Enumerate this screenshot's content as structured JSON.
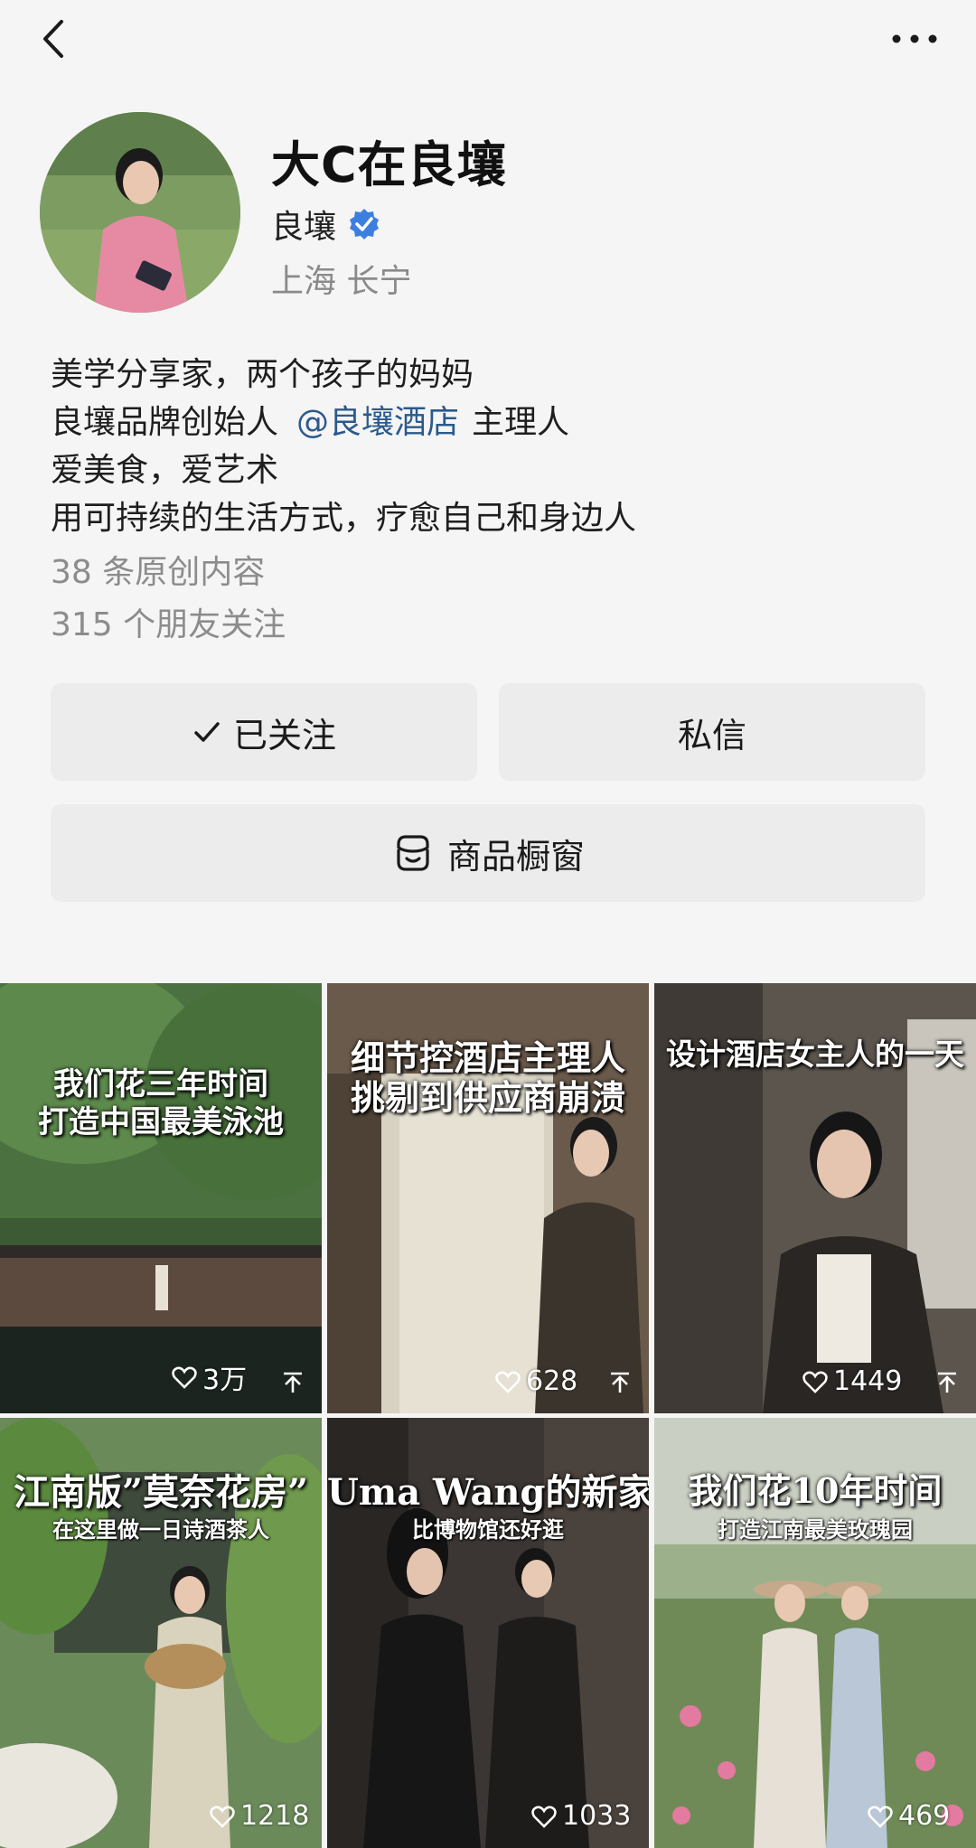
{
  "profile": {
    "name": "大C在良壤",
    "org": "良壤",
    "location": "上海  长宁"
  },
  "bio": {
    "line1": "美学分享家，两个孩子的妈妈",
    "line2_prefix": "良壤品牌创始人",
    "line2_mention": "@良壤酒店",
    "line2_suffix": "主理人",
    "line3": "爱美食，爱艺术",
    "line4": "用可持续的生活方式，疗愈自己和身边人"
  },
  "stats": {
    "original": "38 条原创内容",
    "friends": "315 个朋友关注"
  },
  "actions": {
    "followed": "已关注",
    "message": "私信",
    "shop": "商品橱窗"
  },
  "videos": [
    {
      "title1": "我们花三年时间",
      "title2": "打造中国最美泳池",
      "likes": "3万"
    },
    {
      "title1": "细节控酒店主理人",
      "title2": "挑剔到供应商崩溃",
      "likes": "628"
    },
    {
      "title1": "设计酒店女主人的一天",
      "likes": "1449"
    },
    {
      "title1": "江南版”莫奈花房”",
      "sub": "在这里做一日诗酒茶人",
      "likes": "1218"
    },
    {
      "title1": "Uma Wang的新家",
      "sub": "比博物馆还好逛",
      "likes": "1033"
    },
    {
      "title1": "我们花10年时间",
      "sub": "打造江南最美玫瑰园",
      "likes": "469"
    }
  ],
  "colors": {
    "accent": "#2b5a8c",
    "verified": "#3d7fe0",
    "button_bg": "#ececec",
    "page_bg": "#f5f5f5"
  },
  "icons": {
    "back": "back-chevron-icon",
    "more": "more-dots-icon",
    "verified": "verified-badge-icon",
    "check": "check-icon",
    "shop": "shop-window-icon",
    "heart": "heart-icon",
    "pin": "pin-top-icon"
  }
}
